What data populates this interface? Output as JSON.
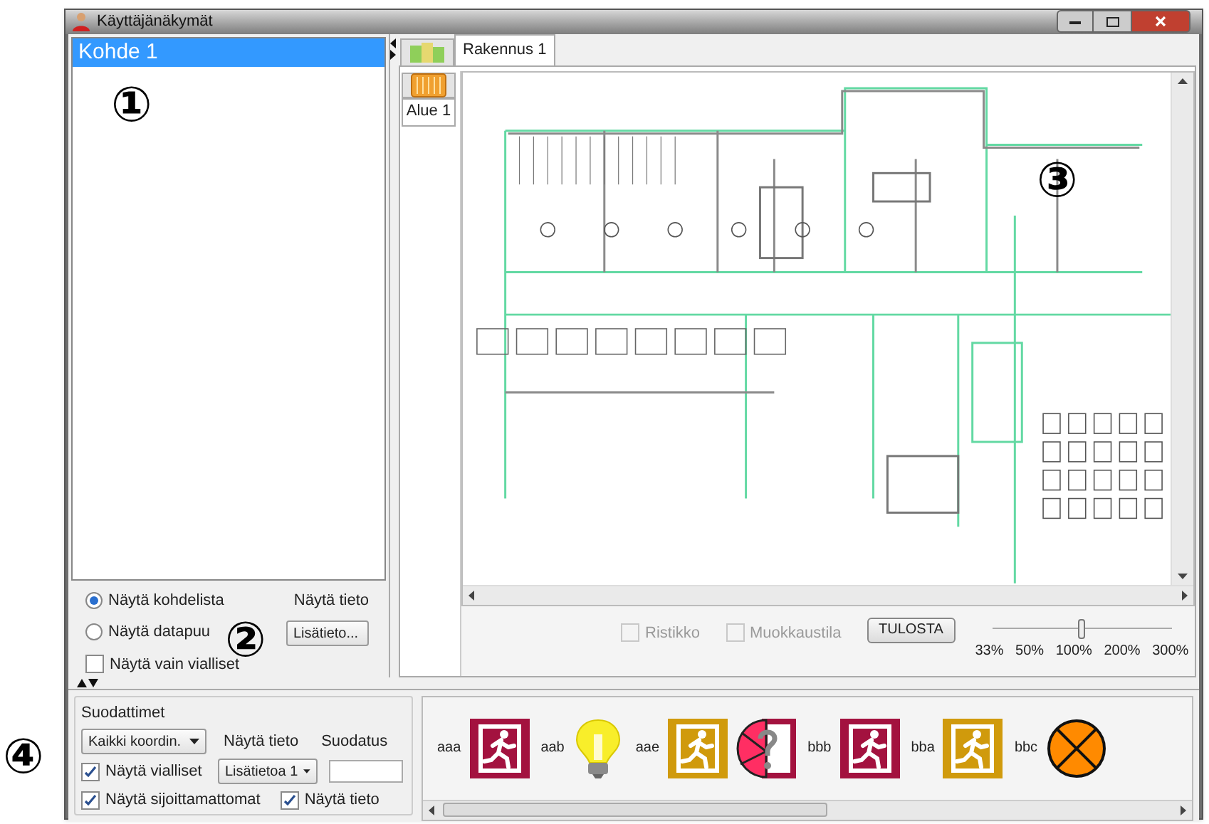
{
  "window": {
    "title": "Käyttäjänäkymät"
  },
  "object_list": {
    "items": [
      {
        "label": "Kohde 1",
        "selected": true
      }
    ]
  },
  "list_options": {
    "radios": [
      {
        "label": "Näytä kohdelista",
        "selected": true
      },
      {
        "label": "Näytä datapuu",
        "selected": false
      }
    ],
    "checkbox": {
      "label": "Näytä vain vialliset",
      "checked": false
    },
    "info_label": "Näytä tieto",
    "info_dropdown": "Lisätieto..."
  },
  "building_tabs": [
    {
      "kind": "icon",
      "selected": false
    },
    {
      "kind": "text",
      "label": "Rakennus 1",
      "selected": true
    }
  ],
  "area_tabs": [
    {
      "kind": "icon",
      "selected": false
    },
    {
      "kind": "text",
      "label": "Alue 1",
      "selected": true
    }
  ],
  "plan_controls": {
    "grid": {
      "label": "Ristikko",
      "checked": false,
      "disabled": true
    },
    "edit_mode": {
      "label": "Muokkaustila",
      "checked": false,
      "disabled": true
    },
    "print_button": "TULOSTA",
    "zoom": {
      "level": 0.5,
      "ticks": [
        "33%",
        "50%",
        "100%",
        "200%",
        "300%"
      ]
    }
  },
  "filters": {
    "title": "Suodattimet",
    "coord_dropdown": "Kaikki koordin.",
    "info_label": "Näytä tieto",
    "info_dropdown": "Lisätietoa 1",
    "filter_label": "Suodatus",
    "checkboxes": [
      {
        "label": "Näytä vialliset",
        "checked": true
      },
      {
        "label": "Näytä sijoittamattomat",
        "checked": true
      },
      {
        "label": "Näytä tieto",
        "checked": true
      }
    ]
  },
  "symbols": [
    {
      "label": "aaa",
      "kind": "exit",
      "color": "#a3123f"
    },
    {
      "label": "aab",
      "kind": "bulb"
    },
    {
      "label": "aae",
      "kind": "exit",
      "color": "#d09a0c"
    },
    {
      "kind": "faulty-exit"
    },
    {
      "label": "bbb",
      "kind": "exit",
      "color": "#a3123f"
    },
    {
      "label": "bba",
      "kind": "exit",
      "color": "#d09a0c"
    },
    {
      "label": "bbc",
      "kind": "lamp-off"
    }
  ],
  "annotations": [
    "①",
    "②",
    "③",
    "④"
  ]
}
